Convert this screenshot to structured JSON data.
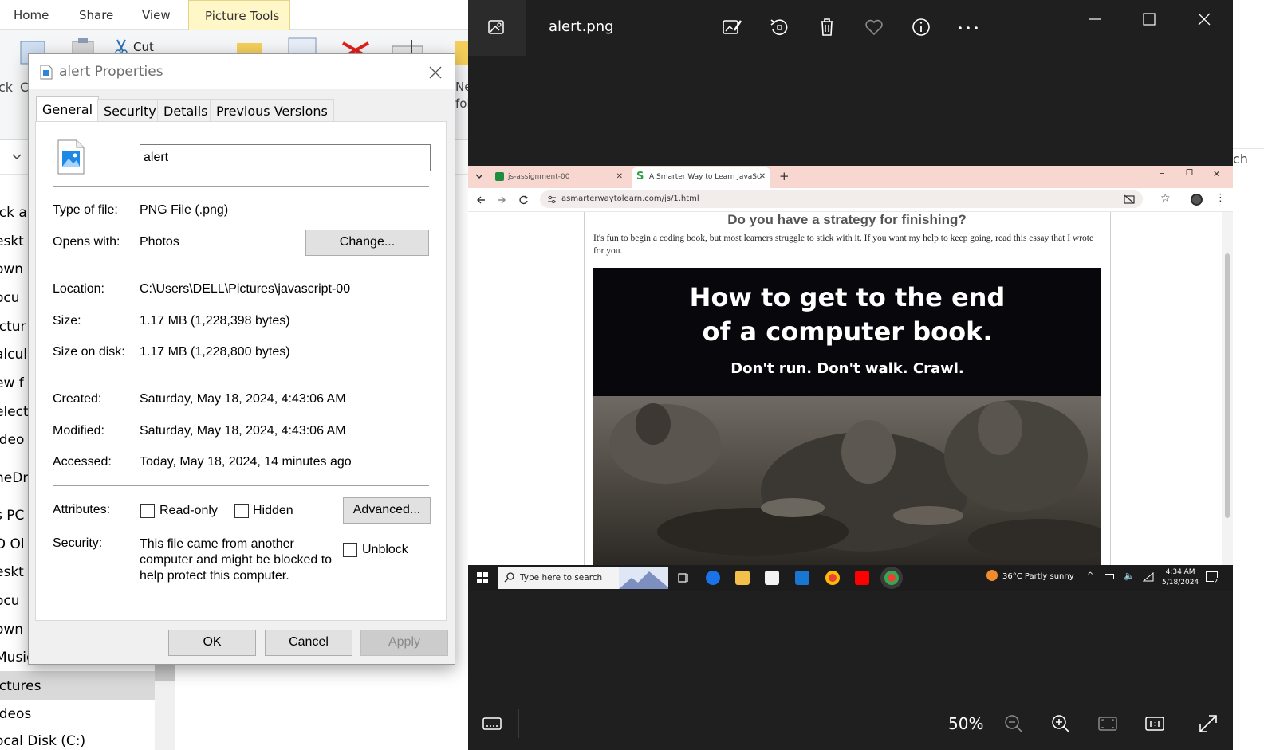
{
  "explorer": {
    "ribbon_tabs": [
      "Home",
      "Share",
      "View"
    ],
    "picture_tools_tab": "Picture Tools",
    "cut_label": "Cut",
    "left_clip": [
      "ck",
      "C"
    ],
    "new_clip": [
      "Ne",
      "fol"
    ],
    "search_clip": "ch",
    "nav_items": [
      "ick a",
      "eskt",
      "own",
      "ocu",
      "ictur",
      "alcul",
      "ew f",
      "elect",
      "ideo",
      "neDri",
      "s PC",
      "D Ol",
      "eskt",
      "ocu",
      "own",
      "Music",
      "ictures",
      "ideos",
      "ocal Disk (C:)"
    ]
  },
  "dialog": {
    "title": "alert Properties",
    "tabs": [
      "General",
      "Security",
      "Details",
      "Previous Versions"
    ],
    "file_name": "alert",
    "type_label": "Type of file:",
    "type_value": "PNG File (.png)",
    "opens_label": "Opens with:",
    "opens_value": "Photos",
    "change_button": "Change...",
    "location_label": "Location:",
    "location_value": "C:\\Users\\DELL\\Pictures\\javascript-00",
    "size_label": "Size:",
    "size_value": "1.17 MB (1,228,398 bytes)",
    "size_disk_label": "Size on disk:",
    "size_disk_value": "1.17 MB (1,228,800 bytes)",
    "created_label": "Created:",
    "created_value": "Saturday, May 18, 2024, 4:43:06 AM",
    "modified_label": "Modified:",
    "modified_value": "Saturday, May 18, 2024, 4:43:06 AM",
    "accessed_label": "Accessed:",
    "accessed_value": "Today, May 18, 2024, 14 minutes ago",
    "attributes_label": "Attributes:",
    "readonly_label": "Read-only",
    "hidden_label": "Hidden",
    "advanced_button": "Advanced...",
    "security_label": "Security:",
    "security_text": "This file came from another computer and might be blocked to help protect this computer.",
    "unblock_label": "Unblock",
    "ok_button": "OK",
    "cancel_button": "Cancel",
    "apply_button": "Apply"
  },
  "photos": {
    "filename": "alert.png",
    "zoom": "50%",
    "icons": [
      "photos-app-icon",
      "edit-image-icon",
      "rotate-icon",
      "delete-icon",
      "favorite-heart-icon",
      "info-icon",
      "more-icon",
      "minimize-icon",
      "maximize-icon",
      "close-icon",
      "filmstrip-icon",
      "zoom-out-icon",
      "zoom-in-icon",
      "fit-icon",
      "actual-size-icon",
      "fullscreen-icon"
    ]
  },
  "browser": {
    "tab1": "js-assignment-00",
    "tab2": "A Smarter Way to Learn JavaScr",
    "url": "asmarterwaytolearn.com/js/1.html",
    "heading": "Do you have a strategy for finishing?",
    "paragraph": "It's fun to begin a coding book, but most learners struggle to stick with it. If you want my help to keep going, read this essay that I wrote for you.",
    "promo_line1": "How to get to the end",
    "promo_line2": "of a computer book.",
    "promo_line3": "Don't run. Don't walk. Crawl."
  },
  "taskbar": {
    "search_placeholder": "Type here to search",
    "weather": "36°C  Partly sunny",
    "time": "4:34 AM",
    "date": "5/18/2024",
    "notification_count": "2"
  },
  "colors": {
    "photos_bg": "#1f1f1f",
    "dialog_bg": "#f0f0f0",
    "browser_tab_strip": "#f7d7cf",
    "picture_tools_tab": "#fff7c7"
  }
}
